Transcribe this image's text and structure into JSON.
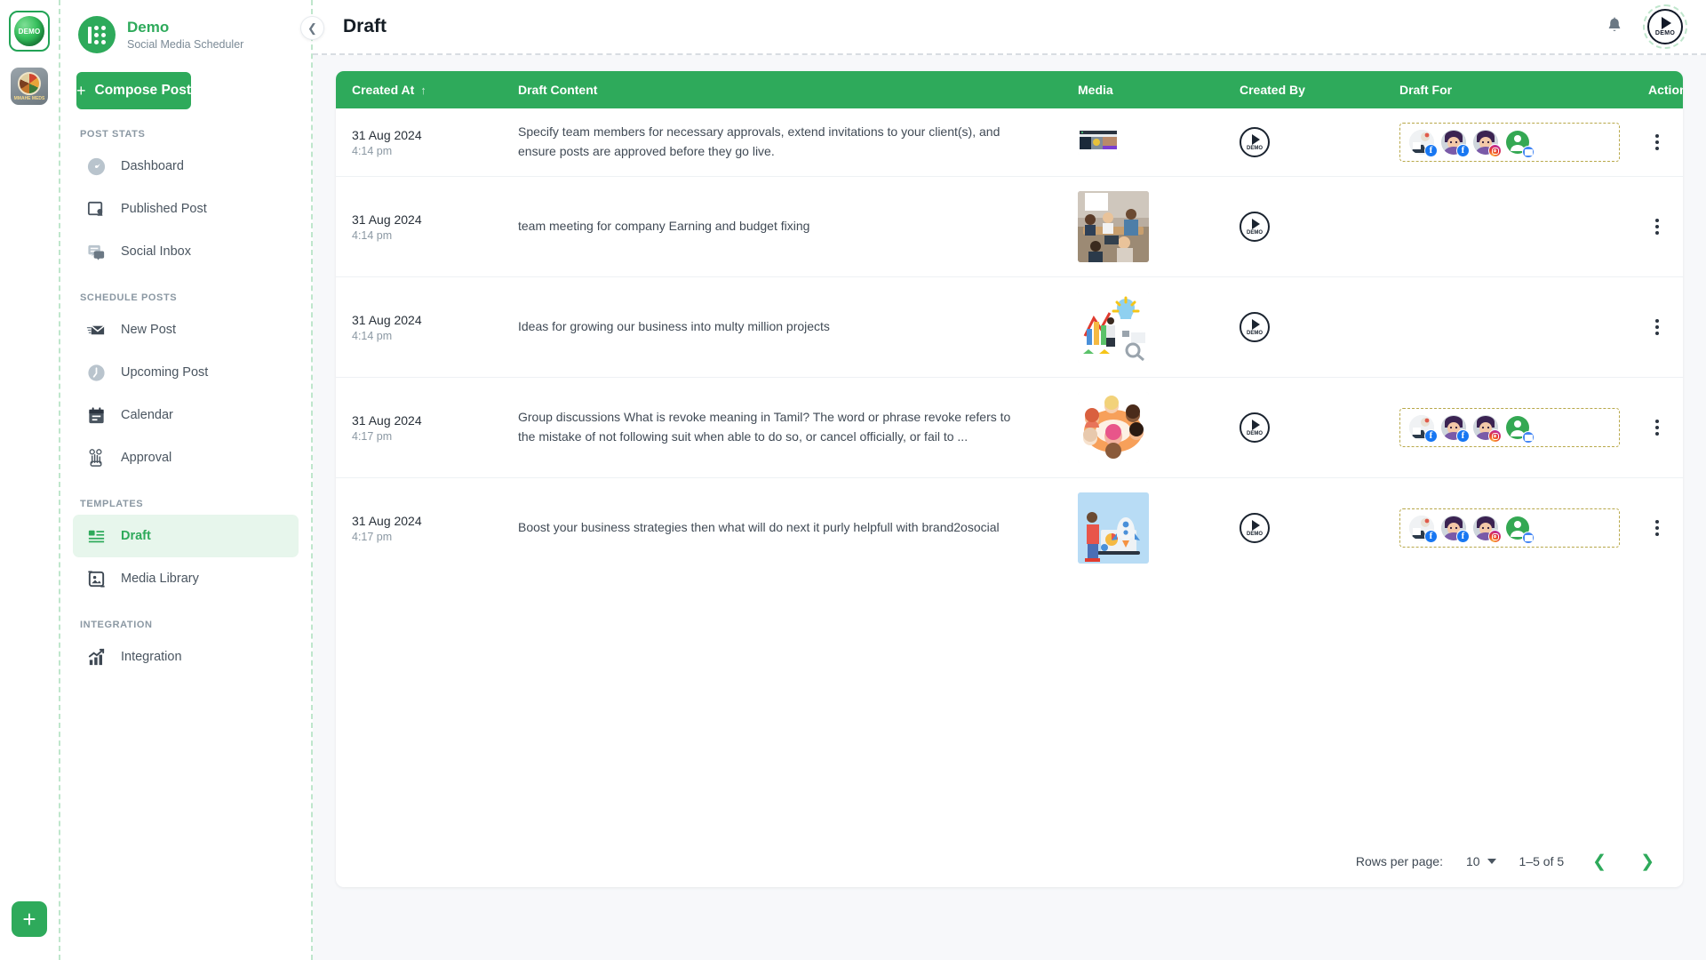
{
  "rail": {
    "apps": [
      {
        "name": "demo-workspace",
        "label": "DEMO",
        "active": true
      },
      {
        "name": "food-workspace",
        "label": "MMAHE MEDS",
        "active": false
      }
    ],
    "add_label": "+"
  },
  "sidebar": {
    "brand": {
      "name": "Demo",
      "subtitle": "Social Media Scheduler"
    },
    "compose_label": "Compose Post",
    "groups": [
      {
        "label": "POST STATS",
        "items": [
          {
            "label": "Dashboard",
            "icon": "gauge-icon",
            "active": false
          },
          {
            "label": "Published Post",
            "icon": "published-post-icon",
            "active": false
          },
          {
            "label": "Social Inbox",
            "icon": "chat-icon",
            "active": false
          }
        ]
      },
      {
        "label": "SCHEDULE POSTS",
        "items": [
          {
            "label": "New Post",
            "icon": "envelope-icon",
            "active": false
          },
          {
            "label": "Upcoming Post",
            "icon": "clock-icon",
            "active": false
          },
          {
            "label": "Calendar",
            "icon": "calendar-icon",
            "active": false
          },
          {
            "label": "Approval",
            "icon": "approval-hand-icon",
            "active": false
          }
        ]
      },
      {
        "label": "TEMPLATES",
        "items": [
          {
            "label": "Draft",
            "icon": "draft-icon",
            "active": true
          },
          {
            "label": "Media Library",
            "icon": "media-library-icon",
            "active": false
          }
        ]
      },
      {
        "label": "INTEGRATION",
        "items": [
          {
            "label": "Integration",
            "icon": "analytics-icon",
            "active": false
          }
        ]
      }
    ]
  },
  "topbar": {
    "title": "Draft",
    "collapse_icon": "chevron-left-icon",
    "notification_icon": "bell-icon",
    "avatar_label": "DEMO"
  },
  "table": {
    "columns": [
      {
        "key": "created_at",
        "label": "Created At",
        "sorted": true,
        "sort_dir": "asc"
      },
      {
        "key": "content",
        "label": "Draft Content"
      },
      {
        "key": "media",
        "label": "Media"
      },
      {
        "key": "created_by",
        "label": "Created By"
      },
      {
        "key": "draft_for",
        "label": "Draft For"
      },
      {
        "key": "action",
        "label": "Action"
      }
    ],
    "rows": [
      {
        "date": "31 Aug 2024",
        "time": "4:14 pm",
        "content": "Specify team members for necessary approvals, extend invitations to your client(s), and ensure posts are approved before they go live.",
        "media": "browser-screenshot-thumbnail",
        "media_size": "small",
        "created_by": "DEMO",
        "draft_for": [
          "facebook",
          "facebook",
          "instagram",
          "google-business"
        ]
      },
      {
        "date": "31 Aug 2024",
        "time": "4:14 pm",
        "content": "team meeting for company Earning and budget fixing",
        "media": "team-meeting-photo",
        "media_size": "large",
        "created_by": "DEMO",
        "draft_for": []
      },
      {
        "date": "31 Aug 2024",
        "time": "4:14 pm",
        "content": "Ideas for growing our business into multy million projects",
        "media": "lightbulb-ideas-illustration",
        "media_size": "large",
        "created_by": "DEMO",
        "draft_for": []
      },
      {
        "date": "31 Aug 2024",
        "time": "4:17 pm",
        "content": "Group discussions What is revoke meaning in Tamil? The word or phrase revoke refers to the mistake of not following suit when able to do so, or cancel officially, or fail to ...",
        "media": "group-discussion-illustration",
        "media_size": "large",
        "created_by": "DEMO",
        "draft_for": [
          "facebook",
          "facebook",
          "instagram",
          "google-business"
        ]
      },
      {
        "date": "31 Aug 2024",
        "time": "4:17 pm",
        "content": "Boost your business strategies then what will do next it purly helpfull with brand2osocial",
        "media": "rocket-laptop-illustration",
        "media_size": "large",
        "created_by": "DEMO",
        "draft_for": [
          "facebook",
          "facebook",
          "instagram",
          "google-business"
        ]
      }
    ]
  },
  "pagination": {
    "rows_per_page_label": "Rows per page:",
    "rows_per_page_value": "10",
    "range_label": "1–5 of 5",
    "prev_icon": "chevron-left-icon",
    "next_icon": "chevron-right-icon"
  },
  "colors": {
    "accent": "#2eaa5b",
    "header_green": "#2eaa5b",
    "draft_for_border": "#b8a84a",
    "page_bg": "#f7f8fa",
    "text": "#283039",
    "muted": "#8b98a3"
  }
}
